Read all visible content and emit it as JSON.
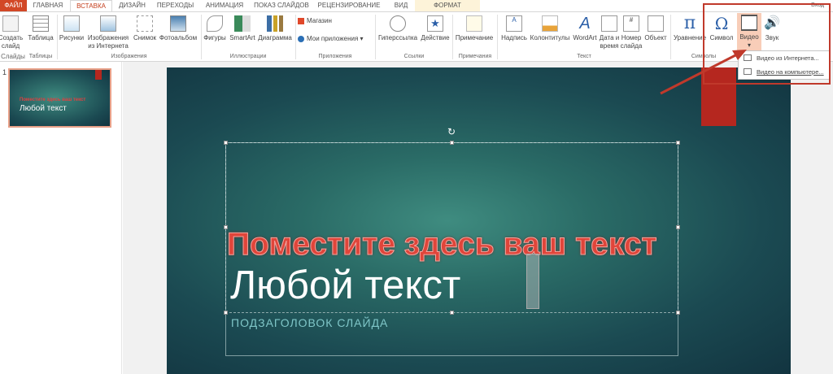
{
  "tabs": [
    "ФАЙЛ",
    "ГЛАВНАЯ",
    "ВСТАВКА",
    "ДИЗАЙН",
    "ПЕРЕХОДЫ",
    "АНИМАЦИЯ",
    "ПОКАЗ СЛАЙДОВ",
    "РЕЦЕНЗИРОВАНИЕ",
    "ВИД",
    "ФОРМАТ"
  ],
  "signin": "Вход",
  "buttons": {
    "new_slide": "Создать слайд",
    "table": "Таблица",
    "pictures": "Рисунки",
    "online_pictures": "Изображения из Интернета",
    "screenshot": "Снимок",
    "photo_album": "Фотоальбом",
    "shapes": "Фигуры",
    "smartart": "SmartArt",
    "chart": "Диаграмма",
    "store": "Магазин",
    "my_apps": "Мои приложения",
    "hyperlink": "Гиперссылка",
    "action": "Действие",
    "comment": "Примечание",
    "textbox": "Надпись",
    "header_footer": "Колонтитулы",
    "wordart": "WordArt",
    "date_time": "Дата и время",
    "slide_number": "Номер слайда",
    "object": "Объект",
    "equation": "Уравнение",
    "symbol": "Символ",
    "video": "Видео",
    "audio": "Звук"
  },
  "groups": [
    "Слайды",
    "Таблицы",
    "Изображения",
    "Иллюстрации",
    "Приложения",
    "Ссылки",
    "Примечания",
    "Текст",
    "Символы"
  ],
  "video_menu": [
    "Видео из Интернета...",
    "Видео на компьютере..."
  ],
  "thumb": {
    "number": "1",
    "title": "Поместите здесь ваш текст",
    "subtitle": "Любой текст"
  },
  "slide": {
    "title": "Поместите здесь ваш текст",
    "text": "Любой текст",
    "subtitle": "ПОДЗАГОЛОВОК СЛАЙДА"
  },
  "colors": {
    "file_tab": "#d24726",
    "accent": "#c43e1c",
    "highlight": "#b5271f"
  }
}
